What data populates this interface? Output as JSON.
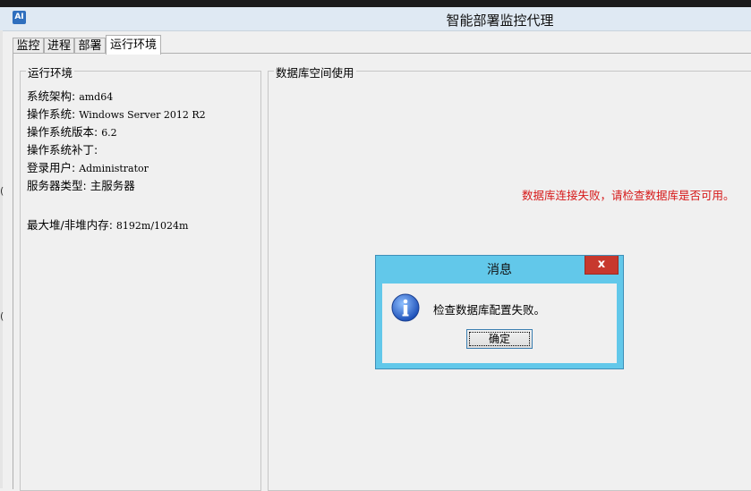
{
  "window": {
    "title": "智能部署监控代理",
    "app_icon_glyph": "AI"
  },
  "tabs": [
    {
      "label": "监控"
    },
    {
      "label": "进程"
    },
    {
      "label": "部署"
    },
    {
      "label": "运行环境",
      "active": true
    }
  ],
  "runtime": {
    "group_title": "运行环境",
    "lines": [
      {
        "label": "系统架构: ",
        "value": "amd64"
      },
      {
        "label": "操作系统: ",
        "value": "Windows Server 2012 R2"
      },
      {
        "label": "操作系统版本: ",
        "value": "6.2"
      },
      {
        "label": "操作系统补丁: ",
        "value": ""
      },
      {
        "label": "登录用户: ",
        "value": "Administrator"
      },
      {
        "label": "服务器类型: ",
        "value": "主服务器"
      },
      {
        "label": "最大堆/非堆内存: ",
        "value": "8192m/1024m"
      }
    ]
  },
  "db": {
    "group_title": "数据库空间使用",
    "error_text": "数据库连接失败，请检查数据库是否可用。"
  },
  "dialog": {
    "title": "消息",
    "close_label": "x",
    "icon": "info-icon",
    "message": "检查数据库配置失败。",
    "ok_label": "确定"
  },
  "edge_fragments": [
    "(",
    "("
  ],
  "colors": {
    "error": "#d61818",
    "dialog_frame": "#62c8ea",
    "close_button": "#c7382d"
  }
}
